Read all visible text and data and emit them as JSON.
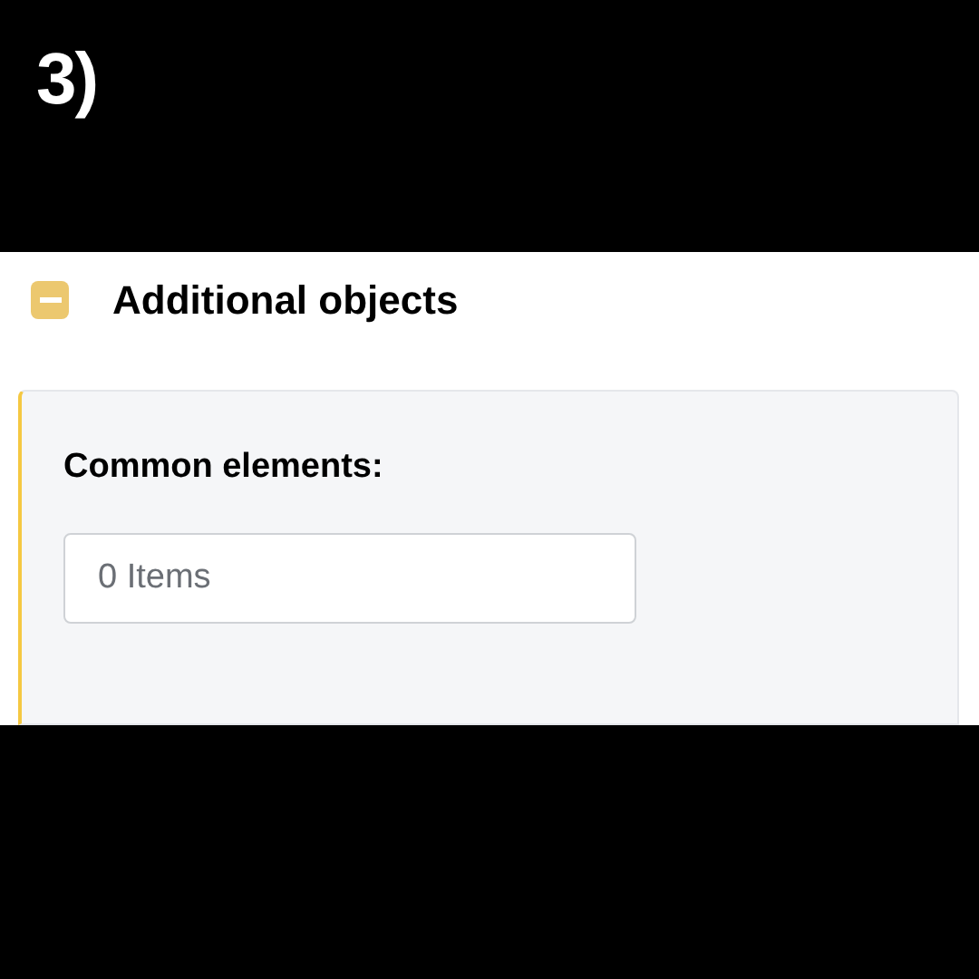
{
  "step_label": "3)",
  "section": {
    "title": "Additional objects",
    "expanded": true,
    "fields": [
      {
        "label": "Common elements:",
        "value": "0 Items"
      }
    ]
  }
}
